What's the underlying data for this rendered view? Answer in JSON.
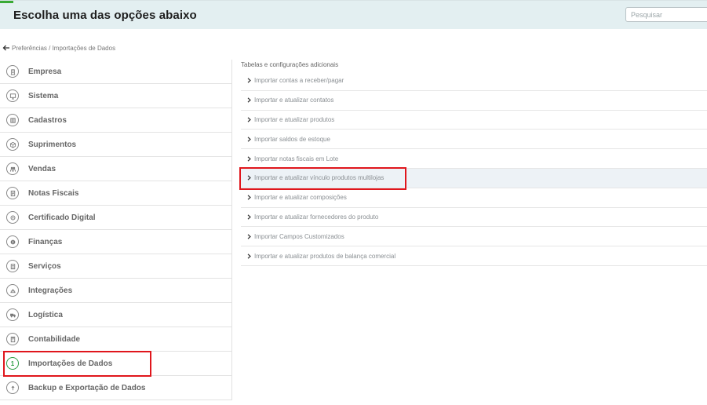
{
  "header": {
    "title": "Escolha uma das opções abaixo",
    "search_placeholder": "Pesquisar",
    "accent_color": "#3aaa35",
    "background_color": "#e3eff1"
  },
  "breadcrumb": {
    "icon": "arrow-left-icon",
    "text": "Preferências / Importações de Dados"
  },
  "sidebar": {
    "items": [
      {
        "icon": "building-icon",
        "label": "Empresa"
      },
      {
        "icon": "monitor-icon",
        "label": "Sistema"
      },
      {
        "icon": "book-icon",
        "label": "Cadastros"
      },
      {
        "icon": "box-icon",
        "label": "Suprimentos"
      },
      {
        "icon": "handshake-icon",
        "label": "Vendas"
      },
      {
        "icon": "receipt-icon",
        "label": "Notas Fiscais"
      },
      {
        "icon": "certificate-icon",
        "label": "Certificado Digital"
      },
      {
        "icon": "coins-icon",
        "label": "Finanças"
      },
      {
        "icon": "clipboard-icon",
        "label": "Serviços"
      },
      {
        "icon": "plug-icon",
        "label": "Integrações"
      },
      {
        "icon": "truck-icon",
        "label": "Logística"
      },
      {
        "icon": "calculator-icon",
        "label": "Contabilidade"
      },
      {
        "icon": "import-icon",
        "label": "Importações de Dados",
        "active": true
      },
      {
        "icon": "backup-icon",
        "label": "Backup e Exportação de Dados"
      }
    ],
    "active_color": "#2e9e44"
  },
  "panel": {
    "title": "Tabelas e configurações adicionais",
    "items": [
      {
        "label": "Importar contas a receber/pagar"
      },
      {
        "label": "Importar e atualizar contatos"
      },
      {
        "label": "Importar e atualizar produtos"
      },
      {
        "label": "Importar saldos de estoque"
      },
      {
        "label": "Importar notas fiscais em Lote"
      },
      {
        "label": "Importar e atualizar vínculo produtos multilojas",
        "selected": true
      },
      {
        "label": "Importar e atualizar composições"
      },
      {
        "label": "Importar e atualizar fornecedores do produto"
      },
      {
        "label": "Importar Campos Customizados"
      },
      {
        "label": "Importar e atualizar produtos de balança comercial"
      }
    ]
  },
  "highlight_color": "#e0161c"
}
